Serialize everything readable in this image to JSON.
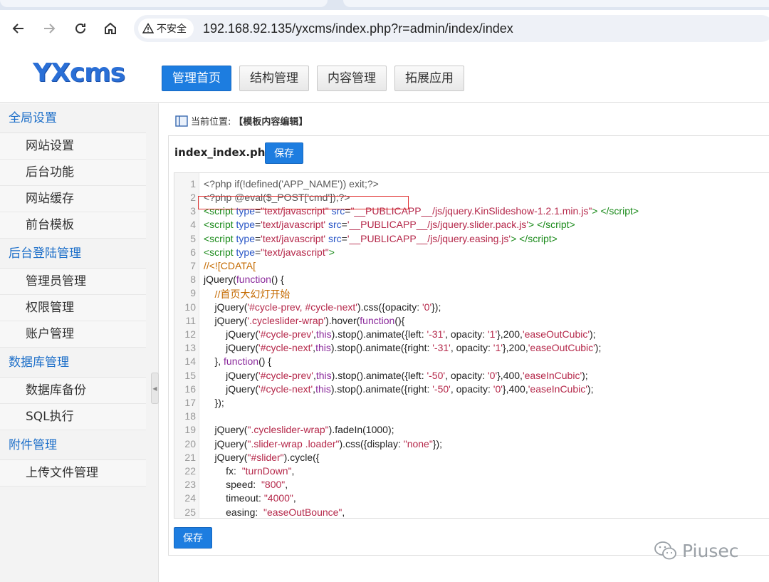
{
  "browser": {
    "security_label": "不安全",
    "url": "192.168.92.135/yxcms/index.php?r=admin/index/index"
  },
  "app": {
    "logo": "YXcms",
    "nav": [
      {
        "label": "管理首页",
        "active": true
      },
      {
        "label": "结构管理",
        "active": false
      },
      {
        "label": "内容管理",
        "active": false
      },
      {
        "label": "拓展应用",
        "active": false
      }
    ]
  },
  "sidebar": {
    "groups": [
      {
        "label": "全局设置",
        "items": [
          "网站设置",
          "后台功能",
          "网站缓存",
          "前台模板"
        ]
      },
      {
        "label": "后台登陆管理",
        "items": [
          "管理员管理",
          "权限管理",
          "账户管理"
        ]
      },
      {
        "label": "数据库管理",
        "items": [
          "数据库备份",
          "SQL执行"
        ]
      },
      {
        "label": "附件管理",
        "items": [
          "上传文件管理"
        ]
      }
    ]
  },
  "main": {
    "breadcrumb_label": "当前位置:",
    "breadcrumb_value": "【模板内容编辑】",
    "file_name": "index_index.php",
    "save_label": "保存",
    "save_bottom_label": "保存"
  },
  "code": {
    "line_numbers": [
      "1",
      "2",
      "3",
      "4",
      "5",
      "6",
      "7",
      "8",
      "9",
      "10",
      "11",
      "12",
      "13",
      "14",
      "15",
      "16",
      "17",
      "18",
      "19",
      "20",
      "21",
      "22",
      "23",
      "24",
      "25"
    ]
  },
  "watermark": "Piusec",
  "colors": {
    "primary": "#1d7de0",
    "sidebar_link": "#1d6fc9",
    "highlight_box": "#e03030"
  }
}
